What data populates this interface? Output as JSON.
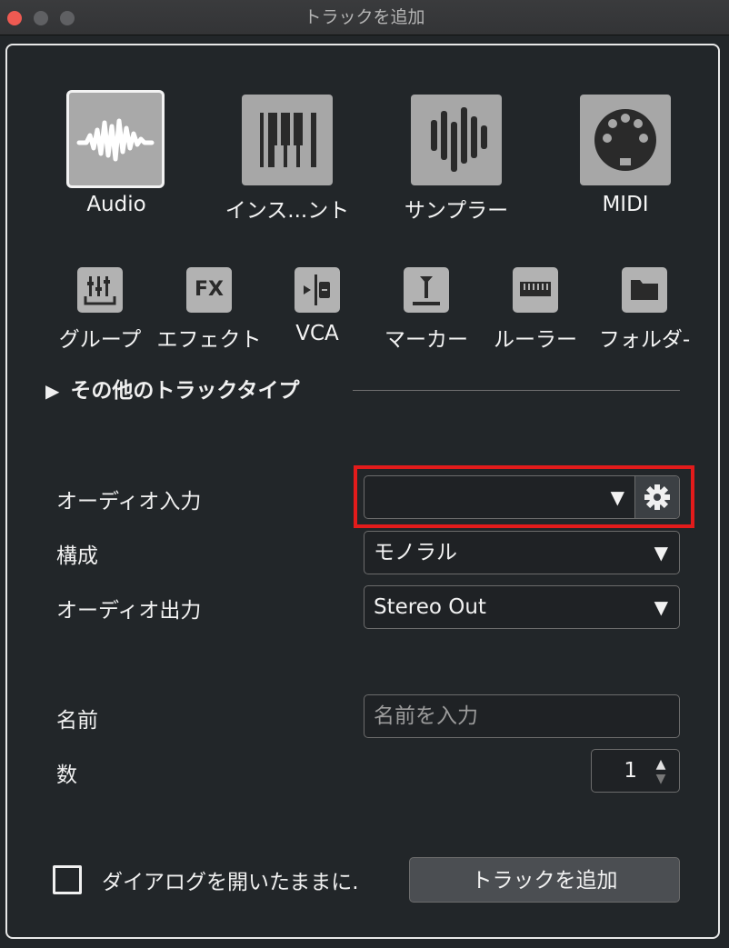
{
  "window": {
    "title": "トラックを追加"
  },
  "track_types_main": [
    {
      "label": "Audio",
      "icon": "audio-waveform-icon",
      "selected": true
    },
    {
      "label": "インス...ント",
      "icon": "piano-keys-icon",
      "selected": false
    },
    {
      "label": "サンプラー",
      "icon": "sampler-bars-icon",
      "selected": false
    },
    {
      "label": "MIDI",
      "icon": "midi-connector-icon",
      "selected": false
    }
  ],
  "track_types_secondary": [
    {
      "label": "グループ",
      "icon": "group-faders-icon"
    },
    {
      "label": "エフェクト",
      "icon": "fx-icon",
      "icon_text": "FX"
    },
    {
      "label": "VCA",
      "icon": "vca-icon"
    },
    {
      "label": "マーカー",
      "icon": "marker-icon"
    },
    {
      "label": "ルーラー",
      "icon": "ruler-icon"
    },
    {
      "label": "フォルダ-",
      "icon": "folder-icon"
    }
  ],
  "other_types": {
    "label": "その他のトラックタイプ",
    "expander": "▶"
  },
  "fields": {
    "audio_input": {
      "label": "オーディオ入力",
      "value": "",
      "arrow": "▼",
      "settings_icon": "gear-icon"
    },
    "config": {
      "label": "構成",
      "value": "モノラル",
      "arrow": "▼"
    },
    "audio_output": {
      "label": "オーディオ出力",
      "value": "Stereo Out",
      "arrow": "▼"
    },
    "name": {
      "label": "名前",
      "placeholder": "名前を入力"
    },
    "count": {
      "label": "数",
      "value": "1",
      "up": "▲",
      "down": "▼"
    }
  },
  "footer": {
    "keep_open_label": "ダイアログを開いたままに.",
    "keep_open_checked": false,
    "add_button": "トラックを追加"
  },
  "colors": {
    "highlight": "#e31b1b",
    "background": "#222629",
    "tile": "#a7a7a7"
  }
}
